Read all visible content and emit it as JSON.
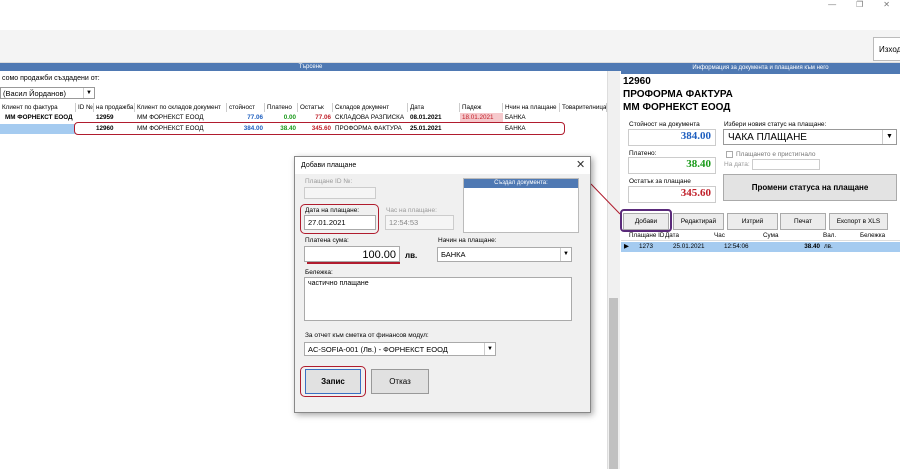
{
  "window": {
    "controls": [
      "—",
      "❐",
      "✕"
    ]
  },
  "toolbar": {
    "exit_label": "Изход"
  },
  "search_panel": {
    "header": "Търсене",
    "sales_by_label": "сомо продажби създадени от:",
    "user_select_value": "(Васил Йорданов)",
    "columns": [
      "Клиент по фактура",
      "ID №",
      "на продажба",
      "Клиент по складов документ",
      "стойност",
      "Платено",
      "Остатък",
      "Складов документ",
      "Дата",
      "Падеж",
      "Нчин на плащане",
      "Товарителница"
    ],
    "rows": [
      {
        "client_invoice": "ММ ФОРНЕКСТ ЕООД",
        "sale_no": "12959",
        "client_stock": "ММ ФОРНЕКСТ ЕООД",
        "value": "77.06",
        "paid": "0.00",
        "rest": "77.06",
        "stock_doc": "СКЛАДОВА РАЗПИСКА",
        "date": "08.01.2021",
        "due": "18.01.2021",
        "payment": "БАНКА"
      },
      {
        "client_invoice": "",
        "sale_no": "12960",
        "client_stock": "ММ ФОРНЕКСТ ЕООД",
        "value": "384.00",
        "paid": "38.40",
        "rest": "345.60",
        "stock_doc": "ПРОФОРМА ФАКТУРА",
        "date": "25.01.2021",
        "due": "",
        "payment": "БАНКА"
      }
    ]
  },
  "info_panel": {
    "header": "Информация за документа и плащания към него",
    "doc_number": "12960",
    "doc_type": "ПРОФОРМА ФАКТУРА",
    "company": "ММ ФОРНЕКСТ ЕООД",
    "doc_value_label": "Стойност на документа",
    "doc_value": "384.00",
    "paid_label": "Платено:",
    "paid": "38.40",
    "rest_label": "Остатък за плащане",
    "rest": "345.60",
    "new_status_label": "Избери новия статус на плащане:",
    "new_status_value": "ЧАКА ПЛАЩАНЕ",
    "not_arrived_label": "Плащането е пристигнало",
    "date_label": "На дата:",
    "change_status_button": "Промени статуса на плащане",
    "tabs": [
      "Добави",
      "Редактирай",
      "Изтрий",
      "Печат",
      "Експорт в XLS"
    ],
    "payments_columns": [
      "Плащане ID",
      "Дата",
      "Час",
      "Сума",
      "Вал.",
      "Бележка"
    ],
    "payments_rows": [
      {
        "id": "1273",
        "date": "25.01.2021",
        "time": "12:54:06",
        "amount": "38.40",
        "currency": "лв.",
        "note": ""
      }
    ]
  },
  "dialog": {
    "title": "Добави плащане",
    "close": "✕",
    "payment_id_label": "Плащане ID №:",
    "payment_id_value": "",
    "creator_header": "Създал документа:",
    "date_label": "Дата на плащане:",
    "date_value": "27.01.2021",
    "time_label": "Час на плащане:",
    "time_value": "12:54:53",
    "amount_label": "Платена сума:",
    "amount_value": "100.00",
    "currency": "лв.",
    "method_label": "Начин на плащане:",
    "method_value": "БАНКА",
    "note_label": "Бележка:",
    "note_value": "частично плащане",
    "account_label": "За отчет към сметка от финансов модул:",
    "account_value": "AC-SOFIA-001 (Лв.)  - ФОРНЕКСТ ЕООД",
    "save_button": "Запис",
    "cancel_button": "Отказ"
  },
  "colors": {
    "accent_header": "#4f79b3",
    "blue_value": "#1f5fbf",
    "green_value": "#1a9a1a",
    "red_value": "#c0202a",
    "highlight": "#b01c2e",
    "selection": "#a5cbf0"
  }
}
